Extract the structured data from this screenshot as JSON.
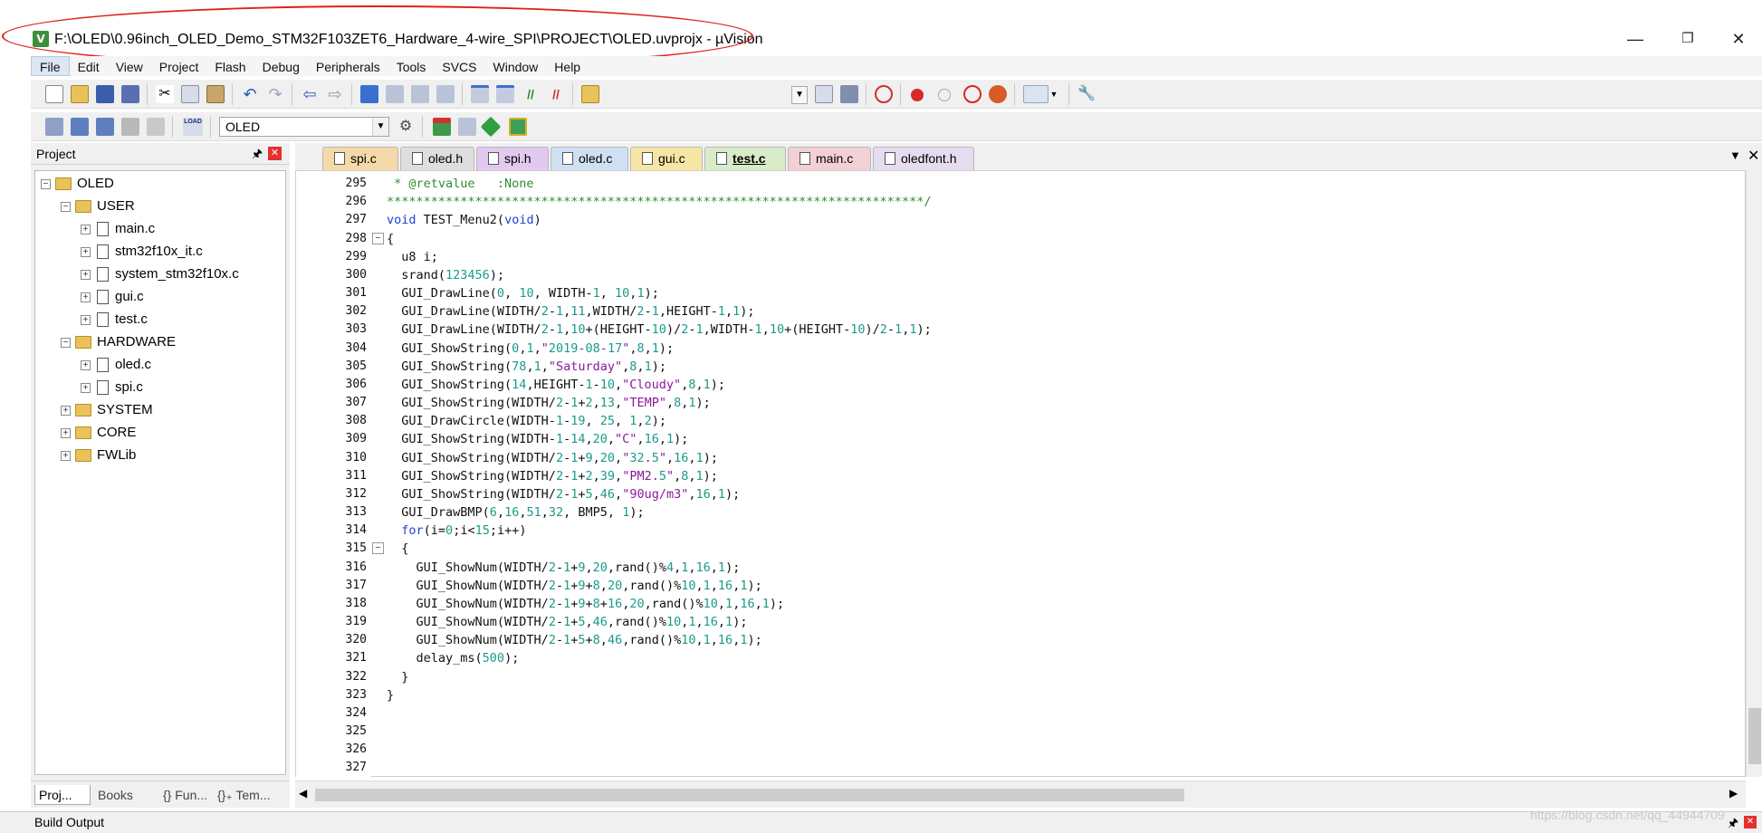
{
  "window": {
    "title": "F:\\OLED\\0.96inch_OLED_Demo_STM32F103ZET6_Hardware_4-wire_SPI\\PROJECT\\OLED.uvprojx - µVision",
    "app_icon": "V",
    "minimize": "—",
    "maximize": "❐",
    "close": "✕"
  },
  "menu": [
    "File",
    "Edit",
    "View",
    "Project",
    "Flash",
    "Debug",
    "Peripherals",
    "Tools",
    "SVCS",
    "Window",
    "Help"
  ],
  "toolbar2": {
    "target": "OLED",
    "load_icon_text": "LOAD"
  },
  "project_panel": {
    "title": "Project",
    "tree": [
      {
        "label": "OLED"
      },
      {
        "label": "USER"
      },
      {
        "label": "main.c"
      },
      {
        "label": "stm32f10x_it.c"
      },
      {
        "label": "system_stm32f10x.c"
      },
      {
        "label": "gui.c"
      },
      {
        "label": "test.c"
      },
      {
        "label": "HARDWARE"
      },
      {
        "label": "oled.c"
      },
      {
        "label": "spi.c"
      },
      {
        "label": "SYSTEM"
      },
      {
        "label": "CORE"
      },
      {
        "label": "FWLib"
      }
    ],
    "bottom_tabs": [
      "Proj...",
      "Books",
      "{} Fun...",
      "{}₊ Tem..."
    ]
  },
  "editor": {
    "tabs": [
      {
        "label": "spi.c",
        "color": "#f5d9a8"
      },
      {
        "label": "oled.h",
        "color": "#dedede"
      },
      {
        "label": "spi.h",
        "color": "#e2c9ef"
      },
      {
        "label": "oled.c",
        "color": "#cfe0f3"
      },
      {
        "label": "gui.c",
        "color": "#f6e6a6"
      },
      {
        "label": "test.c",
        "color": "#d8ecc9"
      },
      {
        "label": "main.c",
        "color": "#f3cfd6"
      },
      {
        "label": "oledfont.h",
        "color": "#e6dcef"
      }
    ],
    "active_tab": "test.c",
    "lines": [
      {
        "n": "295",
        "code": " * @retvalue   :None"
      },
      {
        "n": "296",
        "code": "*************************************************************************/"
      },
      {
        "n": "297",
        "code": "void TEST_Menu2(void)"
      },
      {
        "n": "298",
        "code": "{"
      },
      {
        "n": "299",
        "code": "  u8 i;"
      },
      {
        "n": "300",
        "code": "  srand(123456);"
      },
      {
        "n": "301",
        "code": "  GUI_DrawLine(0, 10, WIDTH-1, 10,1);"
      },
      {
        "n": "302",
        "code": "  GUI_DrawLine(WIDTH/2-1,11,WIDTH/2-1,HEIGHT-1,1);"
      },
      {
        "n": "303",
        "code": "  GUI_DrawLine(WIDTH/2-1,10+(HEIGHT-10)/2-1,WIDTH-1,10+(HEIGHT-10)/2-1,1);"
      },
      {
        "n": "304",
        "code": "  GUI_ShowString(0,1,\"2019-08-17\",8,1);"
      },
      {
        "n": "305",
        "code": "  GUI_ShowString(78,1,\"Saturday\",8,1);"
      },
      {
        "n": "306",
        "code": "  GUI_ShowString(14,HEIGHT-1-10,\"Cloudy\",8,1);"
      },
      {
        "n": "307",
        "code": "  GUI_ShowString(WIDTH/2-1+2,13,\"TEMP\",8,1);"
      },
      {
        "n": "308",
        "code": "  GUI_DrawCircle(WIDTH-1-19, 25, 1,2);"
      },
      {
        "n": "309",
        "code": "  GUI_ShowString(WIDTH-1-14,20,\"C\",16,1);"
      },
      {
        "n": "310",
        "code": "  GUI_ShowString(WIDTH/2-1+9,20,\"32.5\",16,1);"
      },
      {
        "n": "311",
        "code": "  GUI_ShowString(WIDTH/2-1+2,39,\"PM2.5\",8,1);"
      },
      {
        "n": "312",
        "code": "  GUI_ShowString(WIDTH/2-1+5,46,\"90ug/m3\",16,1);"
      },
      {
        "n": "313",
        "code": "  GUI_DrawBMP(6,16,51,32, BMP5, 1);"
      },
      {
        "n": "314",
        "code": "  for(i=0;i<15;i++)"
      },
      {
        "n": "315",
        "code": "  {"
      },
      {
        "n": "316",
        "code": "    GUI_ShowNum(WIDTH/2-1+9,20,rand()%4,1,16,1);"
      },
      {
        "n": "317",
        "code": "    GUI_ShowNum(WIDTH/2-1+9+8,20,rand()%10,1,16,1);"
      },
      {
        "n": "318",
        "code": "    GUI_ShowNum(WIDTH/2-1+9+8+16,20,rand()%10,1,16,1);"
      },
      {
        "n": "319",
        "code": "    GUI_ShowNum(WIDTH/2-1+5,46,rand()%10,1,16,1);"
      },
      {
        "n": "320",
        "code": "    GUI_ShowNum(WIDTH/2-1+5+8,46,rand()%10,1,16,1);"
      },
      {
        "n": "321",
        "code": "    delay_ms(500);"
      },
      {
        "n": "322",
        "code": "  }"
      },
      {
        "n": "323",
        "code": "}"
      },
      {
        "n": "324",
        "code": ""
      },
      {
        "n": "325",
        "code": ""
      },
      {
        "n": "326",
        "code": ""
      },
      {
        "n": "327",
        "code": ""
      }
    ]
  },
  "build_output": {
    "label": "Build Output"
  },
  "watermark": "https://blog.csdn.net/qq_44944709"
}
